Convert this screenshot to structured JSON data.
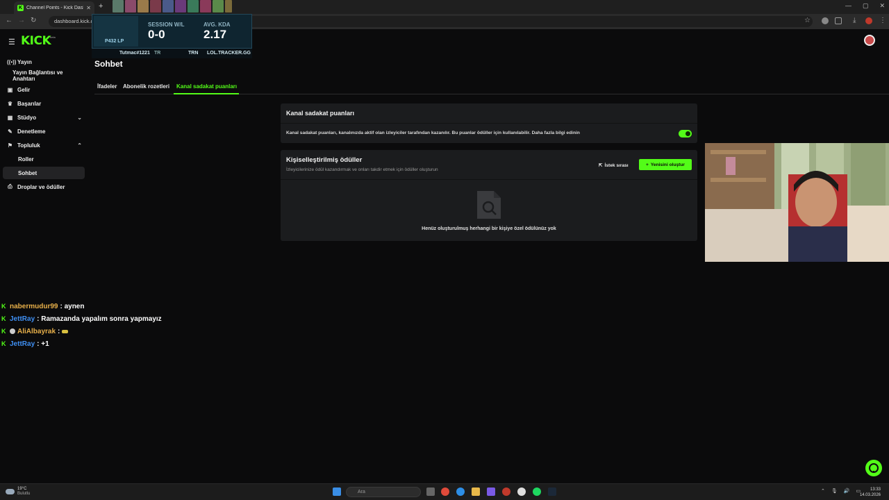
{
  "browser": {
    "tab_title": "Channel Points - Kick Dashboard",
    "new_tab_symbol": "+",
    "url": "dashboard.kick.com/community/chat/channel-points",
    "window_controls": [
      "—",
      "▢",
      "✕"
    ]
  },
  "overlay": {
    "lp": "P432 LP",
    "session_label": "SESSION W/L",
    "session_value": "0-0",
    "kda_label": "AVG. KDA",
    "kda_value": "2.17",
    "summoner": "Tutmac#1221",
    "region": "TR",
    "trn": "TRN",
    "tracker": "LOL.TRACKER.GG"
  },
  "kick": {
    "logo": "KICK",
    "logo_sup": "beta"
  },
  "sidebar": {
    "items": [
      {
        "label": "Yayın",
        "icon": "broadcast-icon"
      },
      {
        "label": "Yayın Bağlantısı ve Anahtarı"
      },
      {
        "label": "Gelir",
        "icon": "revenue-icon"
      },
      {
        "label": "Başarılar",
        "icon": "trophy-icon"
      },
      {
        "label": "Stüdyo",
        "icon": "studio-icon"
      },
      {
        "label": "Denetleme",
        "icon": "moderation-icon"
      },
      {
        "label": "Topluluk",
        "icon": "community-icon"
      },
      {
        "label": "Roller"
      },
      {
        "label": "Sohbet"
      },
      {
        "label": "Droplar ve ödüller",
        "icon": "drops-icon"
      }
    ]
  },
  "page": {
    "title": "Sohbet",
    "tabs": [
      "İfadeler",
      "Abonelik rozetleri",
      "Kanal sadakat puanları"
    ],
    "active_tab": "Kanal sadakat puanları"
  },
  "loyalty_card": {
    "title": "Kanal sadakat puanları",
    "description": "Kanal sadakat puanları, kanalınızda aktif olan izleyiciler tarafından kazanılır. Bu puanlar ödüller için kullanılabilir. Daha fazla bilgi edinin",
    "enabled": true
  },
  "rewards_card": {
    "title": "Kişiselleştirilmiş ödüller",
    "subtitle": "İzleyicilerinize ödül kazandırmak ve onları takdir etmek için ödüller oluşturun",
    "queue_label": "İstek sırası",
    "create_label": "Yenisini oluştur",
    "empty_text": "Henüz oluşturulmuş herhangi bir kişiye özel ödülünüz yok"
  },
  "chat": [
    {
      "user": "nabermudur99",
      "color": "#e8b04a",
      "message": ": aynen"
    },
    {
      "user": "JettRay",
      "color": "#3f8ff2",
      "message": ": Ramazanda yapalım sonra yapmayız"
    },
    {
      "user": "AliAlbayrak",
      "color": "#e8b04a",
      "message": ":"
    },
    {
      "user": "JettRay",
      "color": "#3f8ff2",
      "message": ": +1"
    }
  ],
  "taskbar": {
    "weather_temp": "19°C",
    "weather_desc": "Bulutlu",
    "search_placeholder": "Ara",
    "time": "13:33",
    "date": "14.03.2026"
  },
  "colors": {
    "accent": "#53fc18",
    "card_bg": "#1b1c1e",
    "page_bg": "#0b0b0c"
  }
}
